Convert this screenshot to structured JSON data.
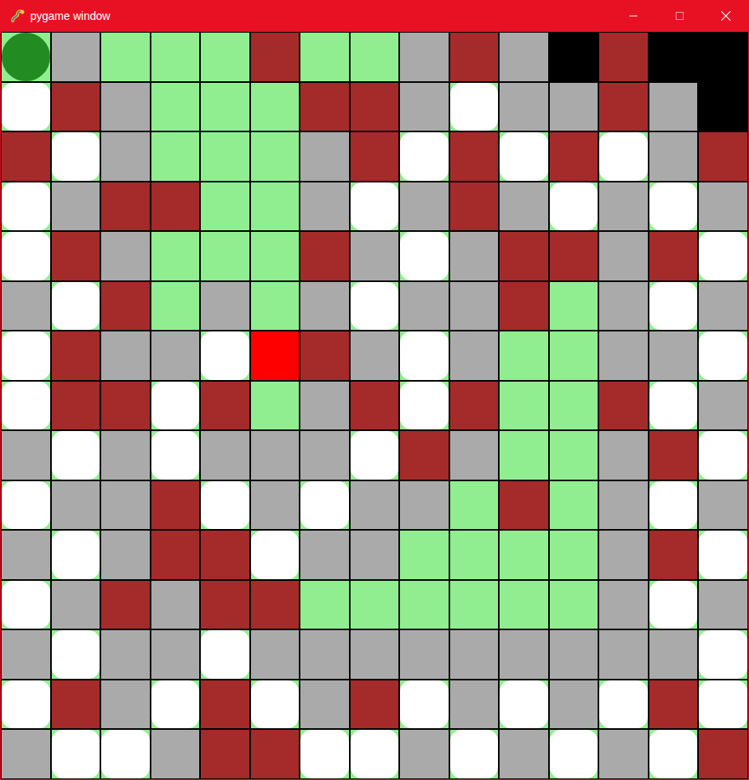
{
  "window": {
    "title": "pygame window",
    "maximize_disabled": true
  },
  "grid": {
    "rows": [
      [
        "agent",
        "free",
        "visited",
        "visited",
        "visited",
        "wall",
        "visited",
        "visited",
        "free",
        "wall",
        "free",
        "unknown",
        "wall",
        "unknown",
        "unknown"
      ],
      [
        "hole",
        "wall",
        "free",
        "visited",
        "visited",
        "visited",
        "wall",
        "wall",
        "free",
        "hole",
        "free",
        "free",
        "wall",
        "free",
        "unknown"
      ],
      [
        "wall",
        "hole",
        "free",
        "visited",
        "visited",
        "visited",
        "free",
        "wall",
        "hole",
        "wall",
        "hole",
        "wall",
        "hole",
        "free",
        "wall"
      ],
      [
        "hole",
        "free",
        "wall",
        "wall",
        "visited",
        "visited",
        "free",
        "hole",
        "free",
        "wall",
        "free",
        "hole",
        "free",
        "hole",
        "free"
      ],
      [
        "hole",
        "wall",
        "free",
        "visited",
        "visited",
        "visited",
        "wall",
        "free",
        "hole",
        "free",
        "wall",
        "wall",
        "free",
        "wall",
        "hole"
      ],
      [
        "free",
        "hole",
        "wall",
        "visited",
        "free",
        "visited",
        "free",
        "hole",
        "free",
        "free",
        "wall",
        "visited",
        "free",
        "hole",
        "free"
      ],
      [
        "hole",
        "wall",
        "free",
        "free",
        "hole",
        "goal",
        "wall",
        "free",
        "hole",
        "free",
        "visited",
        "visited",
        "free",
        "free",
        "hole"
      ],
      [
        "hole",
        "wall",
        "wall",
        "hole",
        "wall",
        "visited",
        "free",
        "wall",
        "hole",
        "wall",
        "visited",
        "visited",
        "wall",
        "hole",
        "free"
      ],
      [
        "free",
        "hole",
        "free",
        "hole",
        "free",
        "free",
        "free",
        "hole",
        "wall",
        "free",
        "visited",
        "visited",
        "free",
        "wall",
        "hole"
      ],
      [
        "hole",
        "free",
        "free",
        "wall",
        "hole",
        "free",
        "hole",
        "free",
        "free",
        "visited",
        "wall",
        "visited",
        "free",
        "hole",
        "free"
      ],
      [
        "free",
        "hole",
        "free",
        "wall",
        "wall",
        "hole",
        "free",
        "free",
        "visited",
        "visited",
        "visited",
        "visited",
        "free",
        "wall",
        "hole"
      ],
      [
        "hole",
        "free",
        "wall",
        "free",
        "wall",
        "wall",
        "visited",
        "visited",
        "visited",
        "visited",
        "visited",
        "visited",
        "free",
        "hole",
        "free"
      ],
      [
        "free",
        "hole",
        "free",
        "free",
        "hole",
        "free",
        "free",
        "free",
        "free",
        "free",
        "free",
        "free",
        "free",
        "free",
        "hole"
      ],
      [
        "hole",
        "wall",
        "free",
        "hole",
        "wall",
        "hole",
        "free",
        "wall",
        "hole",
        "free",
        "hole",
        "free",
        "hole",
        "wall",
        "hole"
      ],
      [
        "free",
        "hole",
        "hole",
        "free",
        "wall",
        "wall",
        "hole",
        "hole",
        "free",
        "hole",
        "free",
        "hole",
        "free",
        "hole",
        "wall"
      ]
    ]
  }
}
